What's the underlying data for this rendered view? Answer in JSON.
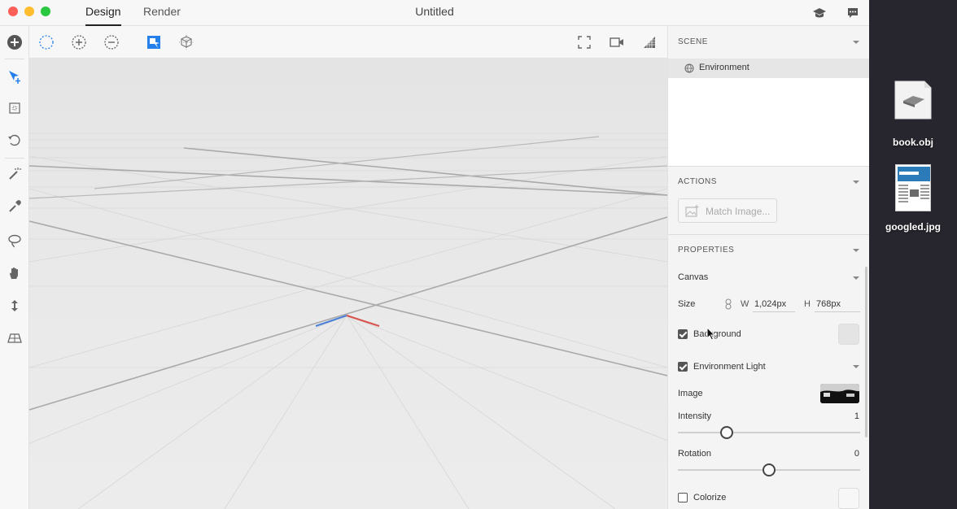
{
  "window": {
    "title": "Untitled",
    "tabs": [
      {
        "label": "Design",
        "active": true
      },
      {
        "label": "Render",
        "active": false
      }
    ],
    "traffic_colors": {
      "close": "#fe5f57",
      "minimize": "#febc2e",
      "zoom": "#28c840"
    }
  },
  "panel": {
    "scene": {
      "header": "SCENE",
      "item": "Environment"
    },
    "actions": {
      "header": "ACTIONS",
      "match_image_label": "Match Image..."
    },
    "properties": {
      "header": "PROPERTIES",
      "canvas_label": "Canvas",
      "size_label": "Size",
      "w_label": "W",
      "w_value": "1,024px",
      "h_label": "H",
      "h_value": "768px",
      "background_label": "Background",
      "background_checked": true,
      "env_light_label": "Environment Light",
      "env_light_checked": true,
      "image_label": "Image",
      "intensity_label": "Intensity",
      "intensity_value": "1",
      "intensity_fraction": 0.27,
      "rotation_label": "Rotation",
      "rotation_value": "0",
      "rotation_fraction": 0.5,
      "colorize_label": "Colorize",
      "colorize_checked": false
    }
  },
  "desktop": {
    "files": [
      {
        "name": "book.obj"
      },
      {
        "name": "googled.jpg"
      }
    ]
  },
  "colors": {
    "accent": "#2680eb",
    "axis_x": "#d9534f",
    "axis_z": "#4a7fd6"
  }
}
